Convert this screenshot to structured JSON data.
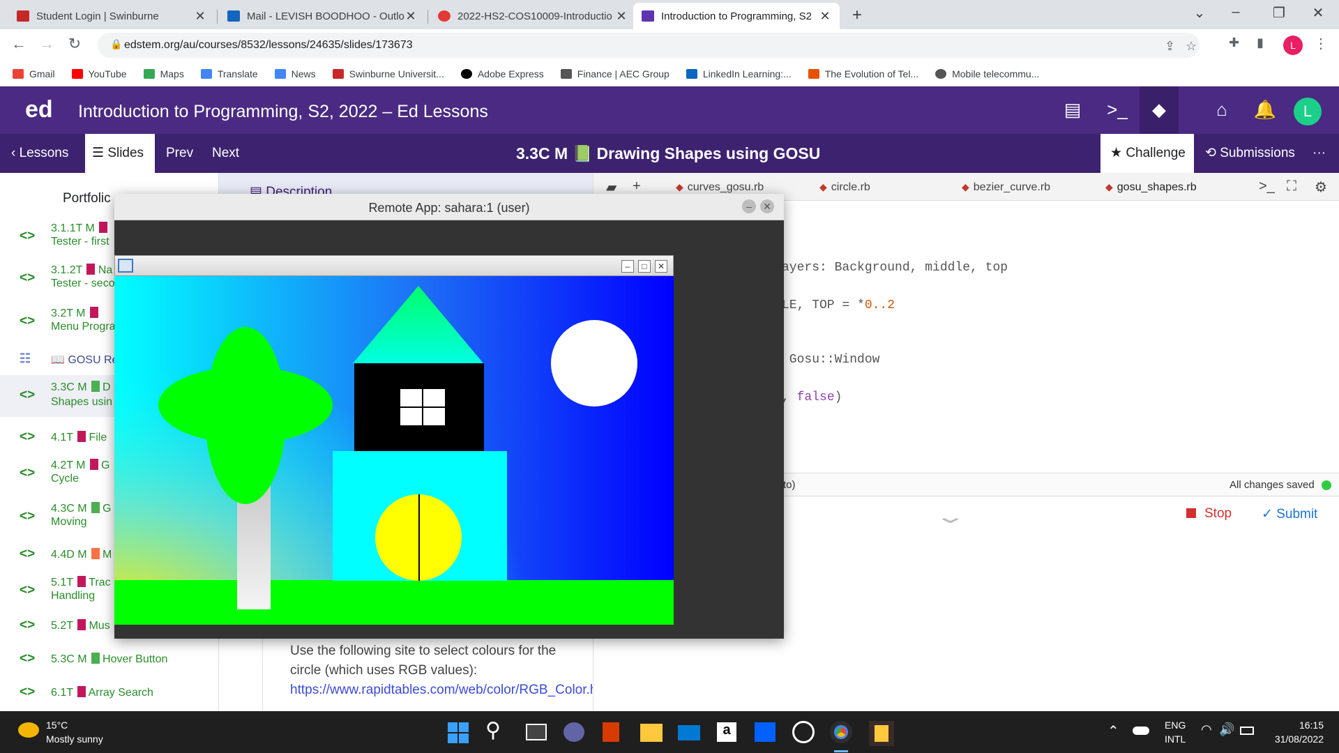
{
  "browser": {
    "tabs": [
      {
        "title": "Student Login | Swinburne",
        "favicon_color": "#c62828"
      },
      {
        "title": "Mail - LEVISH BOODHOO - Outlo",
        "favicon_color": "#1565c0"
      },
      {
        "title": "2022-HS2-COS10009-Introductio",
        "favicon_color": "#e53935"
      },
      {
        "title": "Introduction to Programming, S2",
        "favicon_color": "#5e35b1"
      }
    ],
    "url": "edstem.org/au/courses/8532/lessons/24635/slides/173673",
    "profile_initial": "L",
    "bookmarks": [
      {
        "label": "Gmail",
        "color": "#ea4335"
      },
      {
        "label": "YouTube",
        "color": "#ff0000"
      },
      {
        "label": "Maps",
        "color": "#34a853"
      },
      {
        "label": "Translate",
        "color": "#4285f4"
      },
      {
        "label": "News",
        "color": "#4285f4"
      },
      {
        "label": "Swinburne Universit...",
        "color": "#c62828"
      },
      {
        "label": "Adobe Express",
        "color": "#000000"
      },
      {
        "label": "Finance | AEC Group",
        "color": "#555555"
      },
      {
        "label": "LinkedIn Learning:...",
        "color": "#0a66c2"
      },
      {
        "label": "The Evolution of Tel...",
        "color": "#e65100"
      },
      {
        "label": "Mobile telecommu...",
        "color": "#555555"
      }
    ]
  },
  "ed": {
    "logo": "ed",
    "title": "Introduction to Programming, S2, 2022 – Ed Lessons",
    "avatar_initial": "L",
    "nav": {
      "lessons": "Lessons",
      "slides": "Slides",
      "prev": "Prev",
      "next": "Next"
    },
    "slide_title": "3.3C M 📗 Drawing Shapes using GOSU",
    "challenge": "Challenge",
    "submissions": "Submissions",
    "portfolio": "Portfolic"
  },
  "lessons": [
    {
      "code": "3.1.1T M",
      "name": "Tester - first",
      "status": "#c2185b"
    },
    {
      "code": "3.1.2T",
      "name": "Tester - seco",
      "extra": "Na",
      "status": "#c2185b"
    },
    {
      "code": "3.2T M",
      "name": "Menu Progra",
      "status": "#c2185b"
    },
    {
      "code": "GOSU Re",
      "name": "",
      "status": ""
    },
    {
      "code": "3.3C M",
      "name": "Shapes usin",
      "extra": "D",
      "status": "#4caf50"
    },
    {
      "code": "4.1T",
      "name": "",
      "extra": "File",
      "status": "#c2185b"
    },
    {
      "code": "4.2T M",
      "name": "Cycle",
      "extra": "G",
      "status": "#c2185b"
    },
    {
      "code": "4.3C M",
      "name": "Moving",
      "extra": "G",
      "status": "#4caf50"
    },
    {
      "code": "4.4D M",
      "name": "",
      "extra": "M",
      "status": "#ff7043"
    },
    {
      "code": "5.1T",
      "name": "Handling",
      "extra": "Trac",
      "status": "#c2185b"
    },
    {
      "code": "5.2T",
      "name": "",
      "extra": "Mus",
      "status": "#c2185b"
    },
    {
      "code": "5.3C M",
      "name": "",
      "extra": "Hover Button",
      "status": "#4caf50"
    },
    {
      "code": "6.1T",
      "name": "",
      "extra": "Array Search",
      "status": "#c2185b"
    }
  ],
  "description": {
    "label": "Description",
    "text": "Use the following site to select colours for the circle (which uses RGB values):",
    "link": "https://www.rapidtables.com/web/color/RGB_Color.html"
  },
  "editor": {
    "tabs": [
      "curves_gosu.rb",
      "circle.rb",
      "bezier_curve.rb",
      "gosu_shapes.rb"
    ],
    "code_lines": [
      {
        "pre": "ayers: Background, middle, top"
      },
      {
        "pre": "LE, TOP = *",
        "num": "0..2"
      },
      {
        "pre": " Gosu::Window"
      },
      {
        "pre": ", ",
        "kw": "false",
        "post": ")"
      }
    ],
    "terminal_label": "to)",
    "status": "All changes saved",
    "stop": "Stop",
    "submit": "Submit"
  },
  "remote": {
    "title": "Remote App: sahara:1 (user)",
    "scene_colors": {
      "sky_top": "#0000ff",
      "sky_left": "#00ffff",
      "ground": "#00ff00",
      "tree": "#00ff00",
      "trunk": "#e0e0e0",
      "roof": "#00ff80",
      "house_top": "#000000",
      "house_base": "#00ffff",
      "door": "#ffff00",
      "window": "#ffffff",
      "sun": "#ffffff"
    }
  },
  "taskbar": {
    "weather_temp": "15°C",
    "weather_desc": "Mostly sunny",
    "lang1": "ENG",
    "lang2": "INTL",
    "time": "16:15",
    "date": "31/08/2022"
  }
}
